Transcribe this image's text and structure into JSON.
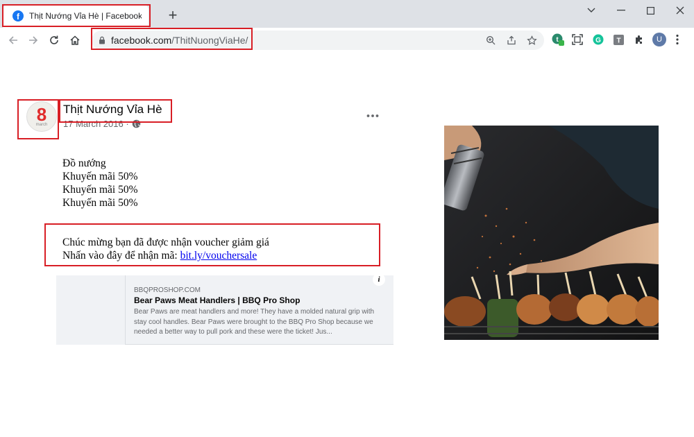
{
  "browser": {
    "tab": {
      "title": "Thịt Nướng Vỉa Hè | Facebook",
      "favicon": "facebook-icon"
    },
    "new_tab_label": "+",
    "url": {
      "domain": "facebook.com",
      "path": "/ThitNuongViaHe/"
    },
    "extensions": [
      "grammar-extension-icon",
      "screenshot-icon",
      "grammarly-icon",
      "text-extension-icon",
      "puzzle-icon"
    ],
    "profile_initial": "U",
    "extension_badge": "3"
  },
  "post": {
    "page_name": "Thịt Nướng Vỉa Hè",
    "date": "17 March 2016 ·",
    "avatar_number": "8",
    "avatar_word": "march",
    "body_lines": [
      "Đồ nướng",
      "Khuyến mãi 50%",
      "Khuyến mãi 50%",
      "Khuyến mãi 50%"
    ],
    "voucher_line": "Chúc mừng bạn đã được nhận voucher giảm giá",
    "link_prefix": "Nhấn vào đây để nhận mã: ",
    "link_text": "bit.ly/vouchersale"
  },
  "preview": {
    "domain": "BBQPROSHOP.COM",
    "title": "Bear Paws Meat Handlers | BBQ Pro Shop",
    "description": "Bear Paws are meat handlers and more! They have a molded natural grip with stay cool handles. Bear Paws were brought to the BBQ Pro Shop because we needed a better way to pull pork and these were the ticket! Jus...",
    "info_label": "i"
  },
  "colors": {
    "annotation": "#d81e25",
    "facebook_blue": "#1877f2",
    "link": "#0000ee"
  }
}
